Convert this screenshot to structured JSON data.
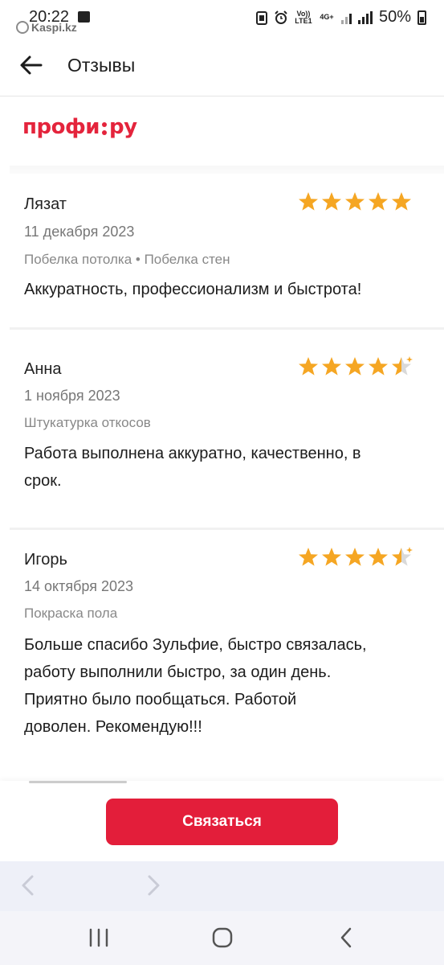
{
  "status_bar": {
    "time": "20:22",
    "battery": "50%",
    "watermark": "Kaspi.kz",
    "network_volte": "Vo)) LTE1",
    "network_4g": "4G+"
  },
  "header": {
    "title": "Отзывы"
  },
  "logo": {
    "left": "профи",
    "right": "ру"
  },
  "reviews": [
    {
      "name": "Лязат",
      "date": "11 декабря 2023",
      "tags": "Побелка потолка • Побелка стен",
      "text_lines": [
        "Аккуратность, профессионализм и быстрота!"
      ],
      "rating": 5
    },
    {
      "name": "Анна",
      "date": "1 ноября 2023",
      "tags": "Штукатурка откосов",
      "text_lines": [
        "Работа выполнена аккуратно, качественно, в",
        "срок."
      ],
      "rating": 4.5
    },
    {
      "name": "Игорь",
      "date": "14 октября 2023",
      "tags": "Покраска пола",
      "text_lines": [
        "Больше спасибо Зульфие, быстро связалась,",
        "работу выполнили быстро, за один день.",
        "Приятно было пообщаться. Работой",
        "доволен. Рекомендую!!!"
      ],
      "rating": 4.5
    }
  ],
  "action": {
    "contact_label": "Связаться"
  },
  "colors": {
    "brand_red": "#e31e3a",
    "star_orange": "#f5a623",
    "star_empty": "#d9d9d9"
  }
}
